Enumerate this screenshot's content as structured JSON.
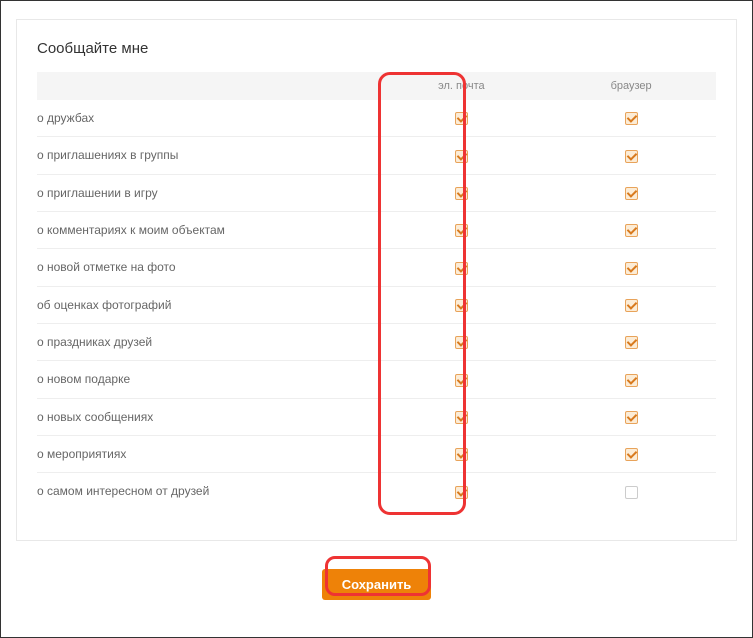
{
  "title": "Сообщайте мне",
  "headers": {
    "label": "",
    "email": "эл. почта",
    "browser": "браузер"
  },
  "rows": [
    {
      "label": "о дружбах",
      "email": true,
      "browser": true
    },
    {
      "label": "о приглашениях в группы",
      "email": true,
      "browser": true
    },
    {
      "label": "о приглашении в игру",
      "email": true,
      "browser": true
    },
    {
      "label": "о комментариях к моим объектам",
      "email": true,
      "browser": true
    },
    {
      "label": "о новой отметке на фото",
      "email": true,
      "browser": true
    },
    {
      "label": "об оценках фотографий",
      "email": true,
      "browser": true
    },
    {
      "label": "о праздниках друзей",
      "email": true,
      "browser": true
    },
    {
      "label": "о новом подарке",
      "email": true,
      "browser": true
    },
    {
      "label": "о новых сообщениях",
      "email": true,
      "browser": true
    },
    {
      "label": "о мероприятиях",
      "email": true,
      "browser": true
    },
    {
      "label": "о самом интересном от друзей",
      "email": true,
      "browser": false
    }
  ],
  "save_label": "Сохранить"
}
